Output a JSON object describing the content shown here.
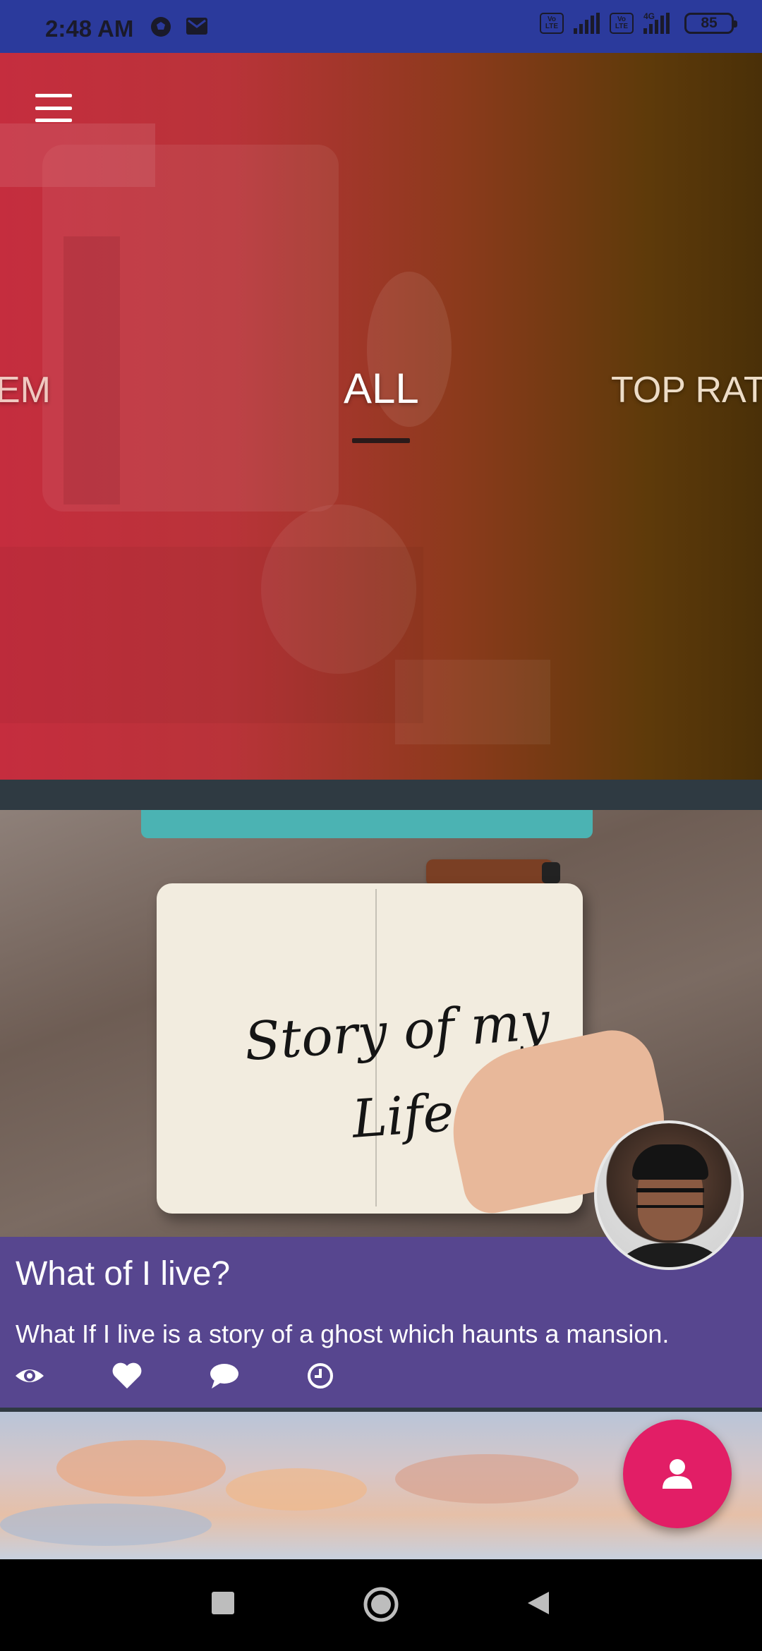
{
  "status_bar": {
    "time": "2:48 AM",
    "network_badge_1": "Vo LTE",
    "network_badge_2": "Vo LTE",
    "network_type": "4G",
    "battery": "85"
  },
  "hero": {
    "tabs": [
      {
        "label": "EM"
      },
      {
        "label": "ALL"
      },
      {
        "label": "TOP RATE"
      }
    ],
    "selected_tab": "ALL"
  },
  "story_card": {
    "image_text": "Story of my Life",
    "title": "What of I live?",
    "description": "What If I live is a story of a ghost which haunts a mansion.",
    "actions": [
      "eye-icon",
      "heart-icon",
      "comment-icon",
      "clock-icon"
    ]
  },
  "colors": {
    "status_bar": "#2b3a9c",
    "card_background": "#57468f",
    "fab": "#e21e66",
    "hero_start": "#c52d3e",
    "hero_end": "#4a3008"
  }
}
